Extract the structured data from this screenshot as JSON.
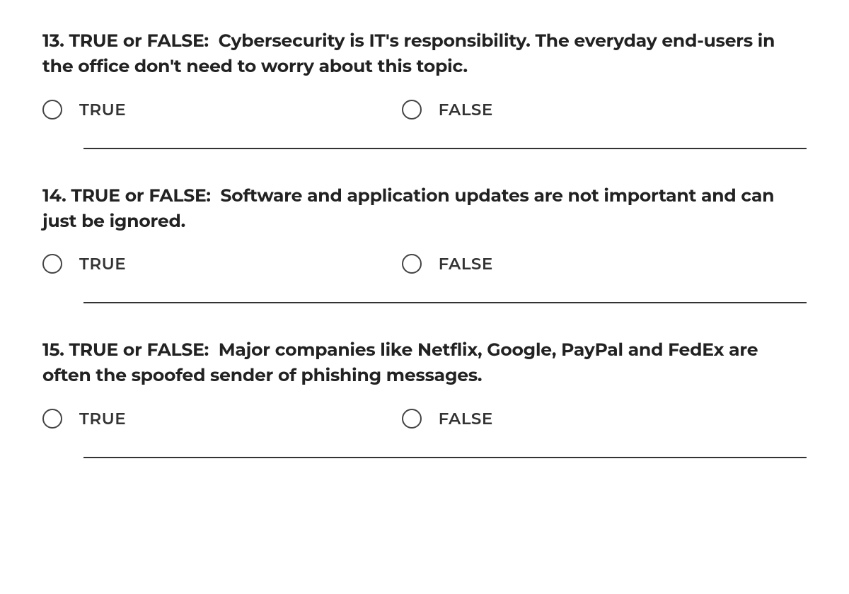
{
  "questions": [
    {
      "number": "13.",
      "prefix": "TRUE or FALSE:",
      "text": "Cybersecurity is IT's responsibility.  The everyday end-users in the office don't need to worry about this topic.",
      "option_true": "TRUE",
      "option_false": "FALSE"
    },
    {
      "number": "14.",
      "prefix": "TRUE or FALSE:",
      "text": "Software and application updates are not important and can just be ignored.",
      "option_true": "TRUE",
      "option_false": "FALSE"
    },
    {
      "number": "15.",
      "prefix": "TRUE or FALSE:",
      "text": "Major companies like Netflix, Google, PayPal and FedEx are often the spoofed sender of phishing messages.",
      "option_true": "TRUE",
      "option_false": "FALSE"
    }
  ]
}
